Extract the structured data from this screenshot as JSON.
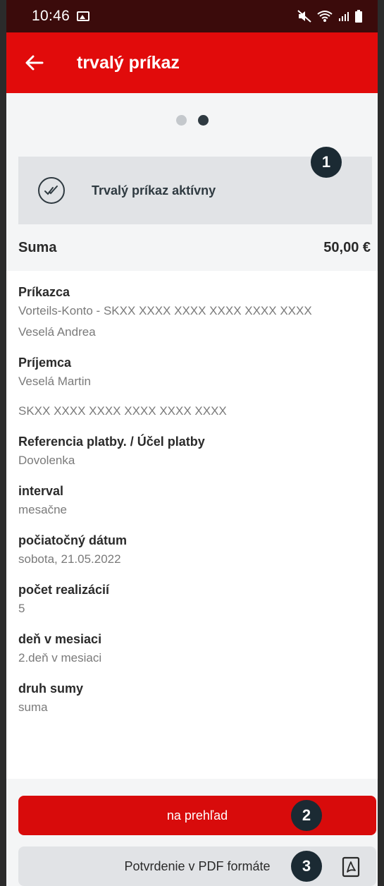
{
  "status_bar": {
    "time": "10:46"
  },
  "app_bar": {
    "title": "trvalý príkaz"
  },
  "pager": {
    "pages": 2,
    "active": 2
  },
  "status_card": {
    "text": "Trvalý príkaz aktívny",
    "badge": "1"
  },
  "sum": {
    "label": "Suma",
    "value": "50,00 €"
  },
  "fields": {
    "payer": {
      "label": "Príkazca",
      "value1": "Vorteils-Konto - SKXX XXXX XXXX XXXX XXXX XXXX",
      "value2": "Veselá Andrea"
    },
    "recipient": {
      "label": "Príjemca",
      "value1": "Veselá Martin",
      "value2": "SKXX XXXX XXXX XXXX XXXX XXXX"
    },
    "reference": {
      "label": "Referencia platby. / Účel platby",
      "value": "Dovolenka"
    },
    "interval": {
      "label": "interval",
      "value": "mesačne"
    },
    "start_date": {
      "label": "počiatočný dátum",
      "value": "sobota, 21.05.2022"
    },
    "count": {
      "label": "počet realizácií",
      "value": "5"
    },
    "day": {
      "label": "deň v mesiaci",
      "value": "2.deň v mesiaci"
    },
    "amount_type": {
      "label": "druh sumy",
      "value": "suma"
    }
  },
  "buttons": {
    "overview": {
      "label": "na prehľad",
      "badge": "2"
    },
    "pdf": {
      "label": "Potvrdenie v PDF formáte",
      "badge": "3"
    }
  },
  "colors": {
    "brand_red": "#e10b0b",
    "status_bar": "#3b0b0b",
    "badge": "#1b2a33",
    "dark_text": "#2f3a41"
  },
  "icons": [
    "back-arrow-icon",
    "gallery-icon",
    "mute-icon",
    "wifi-icon",
    "signal-icon",
    "battery-icon",
    "check-circle-icon",
    "pdf-icon"
  ]
}
